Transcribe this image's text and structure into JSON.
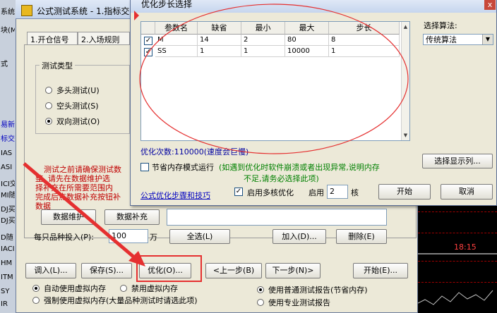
{
  "background_strip": {
    "items": [
      {
        "text": "系统",
        "color": "#000000"
      },
      {
        "text": "块(M)",
        "color": "#000000"
      },
      {
        "text": "式",
        "color": "#000000"
      },
      {
        "text": "易新",
        "color": "#0000c0"
      },
      {
        "text": "标交",
        "color": "#0000c0"
      },
      {
        "text": "IAS",
        "color": "#000000"
      },
      {
        "text": "ASI",
        "color": "#000000"
      },
      {
        "text": "ICI交",
        "color": "#000000"
      },
      {
        "text": "MI随",
        "color": "#000000"
      },
      {
        "text": "DJ买",
        "color": "#000000"
      },
      {
        "text": "DJ买",
        "color": "#000000"
      },
      {
        "text": "D随",
        "color": "#000000"
      },
      {
        "text": "IACI",
        "color": "#000000"
      },
      {
        "text": "HM",
        "color": "#000000"
      },
      {
        "text": "ITM",
        "color": "#000000"
      },
      {
        "text": "SY",
        "color": "#000000"
      },
      {
        "text": "IR",
        "color": "#000000"
      }
    ]
  },
  "right_chart": {
    "time_label": "18:15"
  },
  "main_dialog": {
    "title": "公式测试系统 - 1.指标交易 : ",
    "tabs": [
      "1.开仓信号",
      "2.入场规则"
    ],
    "test_type_group": {
      "title": "测试类型",
      "options": [
        {
          "label": "多头测试(U)",
          "selected": false
        },
        {
          "label": "空头测试(S)",
          "selected": false
        },
        {
          "label": "双向测试(O)",
          "selected": true
        }
      ]
    },
    "red_note_lines": [
      "测试之前请确保测试数",
      "整, 请先在数据维护选",
      "择补充在所需要范围内",
      "完成后点数据补充按钮补",
      "数据"
    ],
    "data_maintain_button": "数据维护",
    "data_supplement_button": "数据补充",
    "per_stock_label": "每只品种投入(P):",
    "per_stock_value": "100",
    "per_stock_unit": "万",
    "select_all_button": "全选(L)",
    "add_button": "加入(D)...",
    "delete_button": "删除(E)",
    "bottom_buttons": {
      "import": "调入(L)...",
      "save": "保存(S)...",
      "optimize": "优化(O)...",
      "prev": "<上一步(B)",
      "next": "下一步(N)>",
      "start": "开始(E)..."
    },
    "memory_options": [
      {
        "label": "自动使用虚拟内存",
        "selected": true
      },
      {
        "label": "禁用虚拟内存",
        "selected": false
      },
      {
        "label": "强制使用虚拟内存(大量品种测试时请选此项)",
        "selected": false
      }
    ],
    "report_options": [
      {
        "label": "使用普通测试报告(节省内存)",
        "selected": true
      },
      {
        "label": "使用专业测试报告",
        "selected": false
      }
    ]
  },
  "popup": {
    "title": "优化步长选择",
    "close_label": "x",
    "columns": [
      "参数名",
      "缺省",
      "最小",
      "最大",
      "步长"
    ],
    "rows": [
      {
        "checked": true,
        "cells": [
          "M",
          "14",
          "2",
          "80",
          "8"
        ]
      },
      {
        "checked": true,
        "cells": [
          "SS",
          "1",
          "1",
          "10000",
          "1"
        ]
      }
    ],
    "algorithm_label": "选择算法:",
    "algorithm_value": "传统算法",
    "optimize_count": "优化次数:110000(速度会巨慢)",
    "save_memory_label": "节省内存模式运行",
    "save_memory_note_line1": "(如遇到优化时软件崩溃或者出现异常,说明内存",
    "save_memory_note_line2": "不足,请务必选择此项)",
    "select_columns_button": "选择显示列...",
    "tips_link": "公式优化步骤和技巧",
    "multicore_label": "启用多核优化",
    "enable_label": "启用",
    "core_count": "2",
    "core_unit": "核",
    "start_button": "开始",
    "cancel_button": "取消"
  },
  "annotation_colors": {
    "highlight": "#e53030"
  }
}
